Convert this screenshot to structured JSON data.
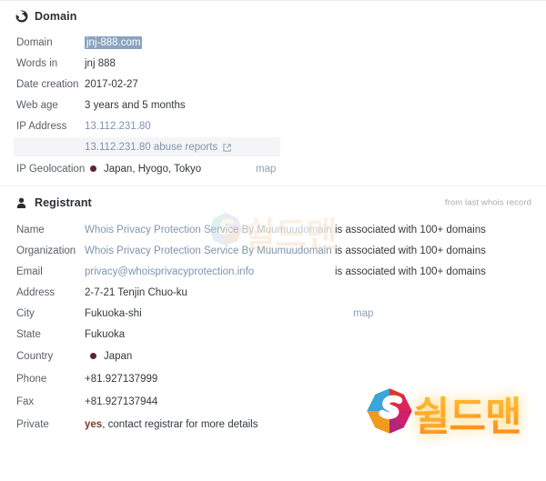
{
  "domain_section": {
    "icon": "globe-icon",
    "title": "Domain",
    "rows": [
      {
        "label": "Domain",
        "value": "jnj-888.com",
        "style": "selected"
      },
      {
        "label": "Words in",
        "value": "jnj 888",
        "style": "plain"
      },
      {
        "label": "Date creation",
        "value": "2017-02-27",
        "style": "plain"
      },
      {
        "label": "Web age",
        "value": "3 years and 5 months",
        "style": "plain"
      },
      {
        "label": "IP Address",
        "value": "13.112.231.80",
        "style": "link"
      },
      {
        "label": "",
        "value": "13.112.231.80 abuse reports",
        "style": "link-shaded",
        "icon": "external-link-icon"
      },
      {
        "label": "IP Geolocation",
        "value": "Japan, Hyogo, Tokyo",
        "style": "dot",
        "extra": "map",
        "extra_name": "map-link"
      }
    ]
  },
  "registrant_section": {
    "icon": "user-icon",
    "title": "Registrant",
    "note": "from last whois record",
    "rows": [
      {
        "label": "Name",
        "value": "Whois Privacy Protection Service By Muumuudomain",
        "style": "link-fade",
        "extra": "is associated with 100+ domains"
      },
      {
        "label": "Organization",
        "value": "Whois Privacy Protection Service By Muumuudomain",
        "style": "link",
        "extra": "is associated with 100+ domains"
      },
      {
        "label": "Email",
        "value": "privacy@whoisprivacyprotection.info",
        "style": "link",
        "extra": "is associated with 100+ domains"
      },
      {
        "label": "Address",
        "value": "2-7-21 Tenjin Chuo-ku",
        "style": "plain"
      },
      {
        "label": "City",
        "value": "Fukuoka-shi",
        "style": "plain",
        "extra": "map",
        "extra_name": "map-link"
      },
      {
        "label": "State",
        "value": "Fukuoka",
        "style": "plain"
      },
      {
        "label": "Country",
        "value": "Japan",
        "style": "dot"
      },
      {
        "label": "Phone",
        "value": "+81.927137999",
        "style": "plain"
      },
      {
        "label": "Fax",
        "value": "+81.927137944",
        "style": "plain"
      },
      {
        "label": "Private",
        "value_strong": "yes",
        "value_rest": ", contact registrar for more details",
        "style": "private"
      }
    ]
  },
  "watermarks": {
    "top": {
      "text": "쉴드맨",
      "logo": "shield-man-s-logo"
    },
    "bottom": {
      "text": "쉴드맨",
      "logo": "shield-man-s-logo"
    }
  },
  "colors": {
    "link": "#7e93ad",
    "selection_bg": "#8ba3bd",
    "dot": "#5c2230",
    "shaded_row": "#f5f5f7",
    "accent_orange": "#f97316"
  }
}
